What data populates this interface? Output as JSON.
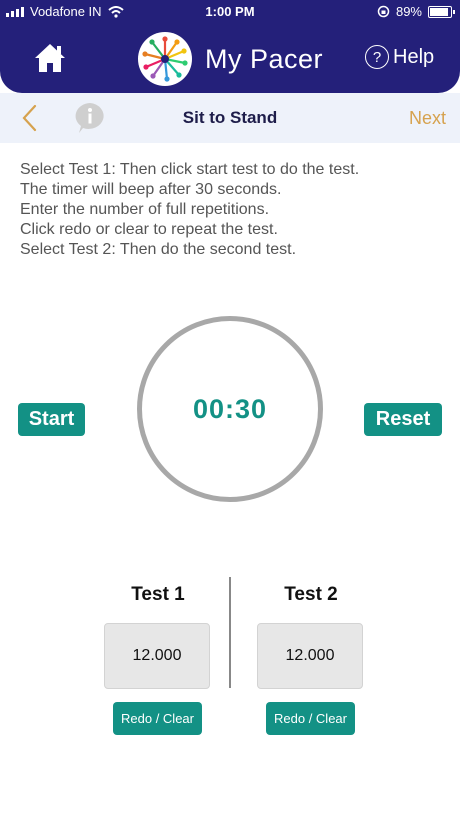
{
  "status_bar": {
    "carrier": "Vodafone IN",
    "time": "1:00 PM",
    "battery": "89%",
    "battery_level": 0.89
  },
  "app_header": {
    "title": "My Pacer",
    "help_label": "Help"
  },
  "nav": {
    "title": "Sit to Stand",
    "next_label": "Next"
  },
  "instructions": [
    "Select Test 1: Then click start test to do the test.",
    "The timer will beep after 30 seconds.",
    "Enter the number of full repetitions.",
    "Click redo or clear to repeat the test.",
    "Select Test 2: Then do the second test."
  ],
  "timer": {
    "display": "00:30",
    "start_label": "Start",
    "reset_label": "Reset"
  },
  "tests": [
    {
      "label": "Test 1",
      "value": "12.000",
      "redo_label": "Redo / Clear"
    },
    {
      "label": "Test 2",
      "value": "12.000",
      "redo_label": "Redo / Clear"
    }
  ],
  "colors": {
    "header": "#24207a",
    "accent": "#139185",
    "next": "#d6a24e",
    "ring": "#a8a8a8"
  }
}
